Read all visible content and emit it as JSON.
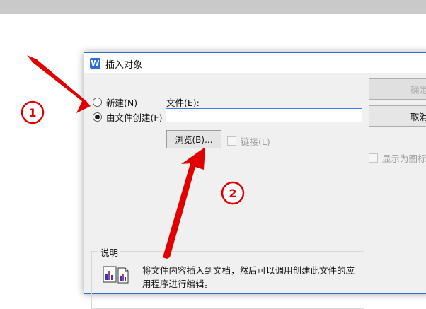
{
  "dialog": {
    "title": "插入对象",
    "app_icon": "W",
    "options": [
      {
        "label": "新建(N)",
        "selected": false
      },
      {
        "label": "由文件创建(F)",
        "selected": true
      }
    ],
    "file": {
      "label": "文件(E):",
      "value": "",
      "browse_label": "浏览(B)...",
      "link_label": "链接(L)"
    },
    "buttons": {
      "ok_label": "确定",
      "cancel_label": "取消"
    },
    "display_as_icon_label": "显示为图标(",
    "result": {
      "title": "说明",
      "text": "将文件内容插入到文档，然后可以调用创建此文件的应用程序进行编辑。"
    }
  },
  "annotations": {
    "marker_1": "1",
    "marker_2": "2",
    "color": "#e00000"
  },
  "colors": {
    "accent": "#2b6ed6",
    "dialog_bg": "#f0f0f0"
  }
}
